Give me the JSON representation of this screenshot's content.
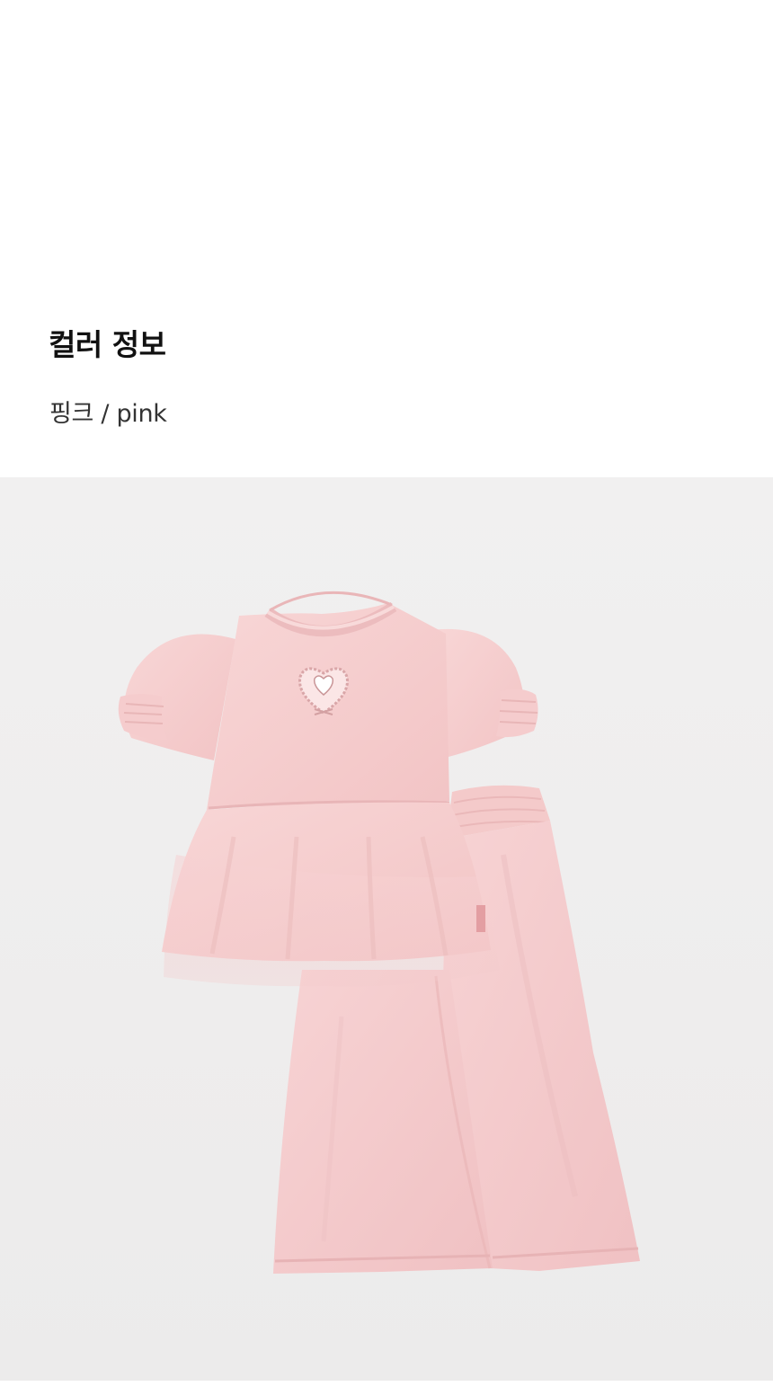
{
  "color_info": {
    "title": "컬러 정보",
    "value": "핑크 / pink"
  },
  "product_photo": {
    "background_color": "#f0efef",
    "garment_color": "#f6cfcf",
    "description_icon": "pink-peplum-top-and-wide-pants-set"
  }
}
